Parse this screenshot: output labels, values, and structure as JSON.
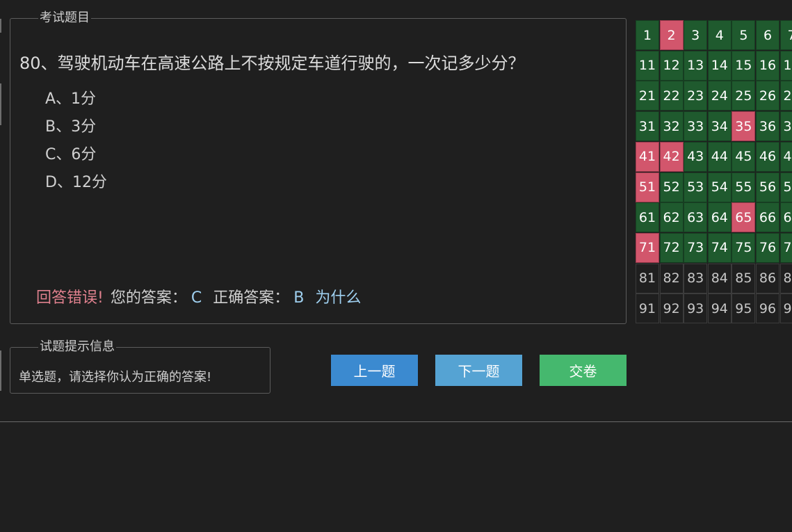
{
  "question_panel": {
    "legend": "考试题目",
    "question_text": "80、驾驶机动车在高速公路上不按规定车道行驶的，一次记多少分？",
    "options": [
      "A、1分",
      "B、3分",
      "C、6分",
      "D、12分"
    ],
    "result": {
      "status_text": "回答错误!",
      "your_answer_label": "您的答案：",
      "your_answer": "C",
      "correct_answer_label": "正确答案：",
      "correct_answer": "B",
      "why_link": "为什么"
    }
  },
  "hint_panel": {
    "legend": "试题提示信息",
    "text": "单选题，请选择你认为正确的答案!"
  },
  "buttons": {
    "prev": "上一题",
    "next": "下一题",
    "submit": "交卷"
  },
  "answer_grid": {
    "columns_visible": 7,
    "rows": 10,
    "wrong_questions": [
      2,
      35,
      41,
      42,
      51,
      65,
      71
    ],
    "answered_through": 80,
    "colors": {
      "correct": "#1f5a2e",
      "wrong": "#d2566c",
      "unanswered": "#1f1f1f"
    }
  }
}
